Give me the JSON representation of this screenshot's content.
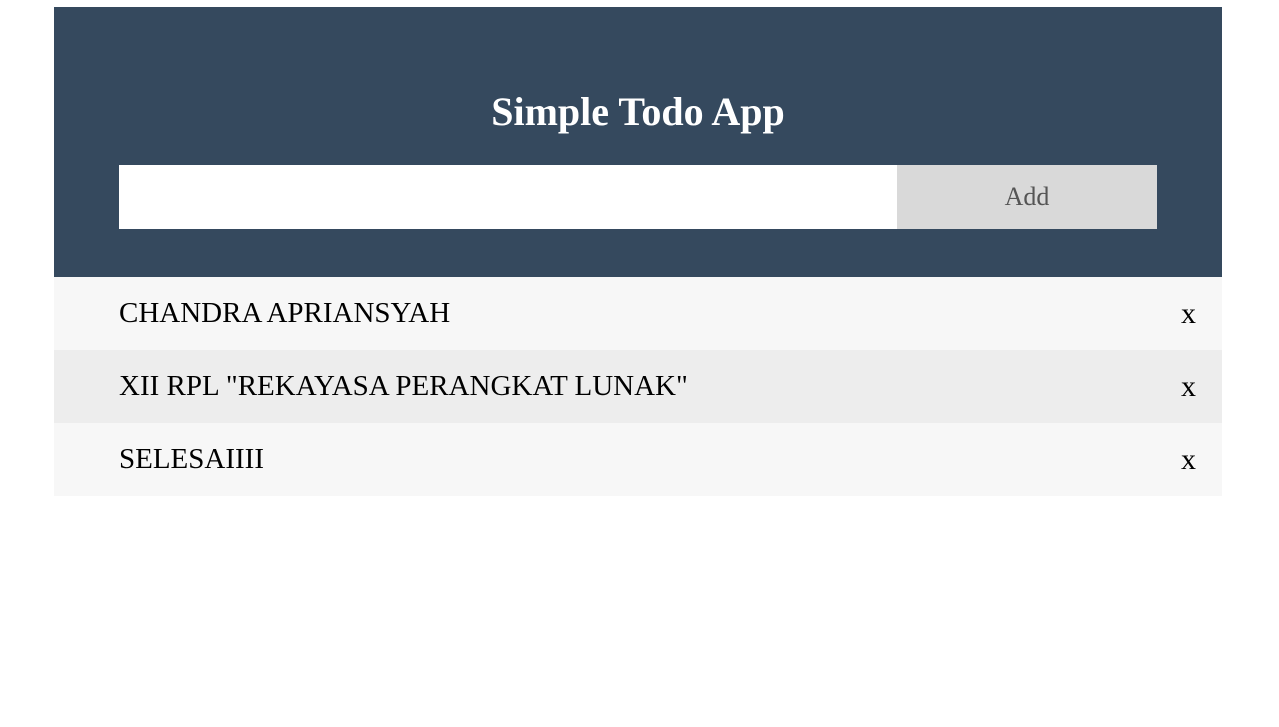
{
  "header": {
    "title": "Simple Todo App",
    "input": {
      "value": "",
      "placeholder": ""
    },
    "add_label": "Add",
    "background": "#35495e"
  },
  "todos": [
    {
      "text": "CHANDRA APRIANSYAH",
      "delete_label": "x"
    },
    {
      "text": "XII RPL \"REKAYASA PERANGKAT LUNAK\"",
      "delete_label": "x"
    },
    {
      "text": "SELESAIIII",
      "delete_label": "x"
    }
  ]
}
